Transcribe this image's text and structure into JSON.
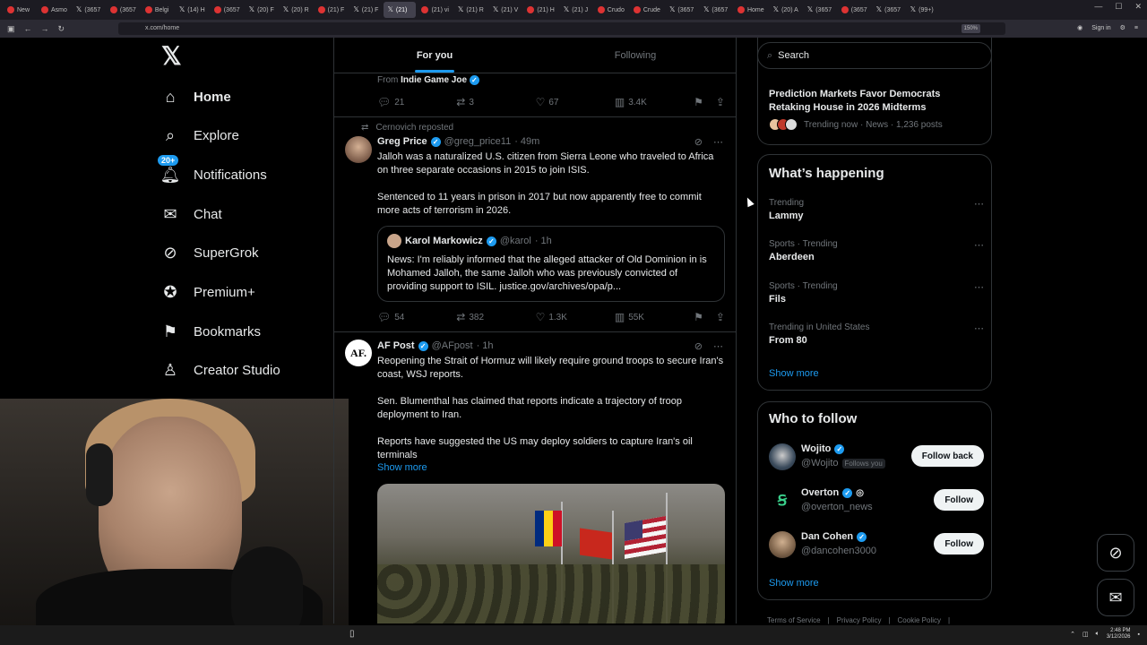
{
  "browser": {
    "tabs": [
      "New",
      "Asmo",
      "(3657",
      "(3657",
      "Belgi",
      "(14) H",
      "(3657",
      "(20) F",
      "(20) R",
      "(21) F",
      "(21) F",
      "(21)",
      "(21) vi",
      "(21) R",
      "(21) V",
      "(21) H",
      "(21) J",
      "Crudo",
      "Crude",
      "(3657",
      "(3657",
      "Home",
      "(20) A",
      "(3657",
      "(3657",
      "(3657",
      "(99+)"
    ],
    "active_tab_index": 11,
    "url": "x.com/home",
    "zoom": "150%",
    "signin": "Sign in"
  },
  "nav": {
    "home": "Home",
    "explore": "Explore",
    "notifications": "Notifications",
    "notifications_badge": "20+",
    "chat": "Chat",
    "supergrok": "SuperGrok",
    "premium": "Premium+",
    "bookmarks": "Bookmarks",
    "creator_studio": "Creator Studio"
  },
  "feed": {
    "tabs": [
      "For you",
      "Following"
    ],
    "prev": {
      "from_prefix": "From",
      "from_name": "Indie Game Joe",
      "replies": "21",
      "reposts": "3",
      "likes": "67",
      "views": "3.4K"
    },
    "tweet1": {
      "reposted_by": "Cernovich reposted",
      "name": "Greg Price",
      "handle": "@greg_price11",
      "time": "· 49m",
      "body": "Jalloh was a naturalized U.S. citizen from Sierra Leone who traveled to Africa on three separate occasions in 2015 to join ISIS.\n\nSentenced to 11 years in prison in 2017 but now apparently free to commit more acts of terrorism in 2026.",
      "quote_name": "Karol Markowicz",
      "quote_handle": "@karol",
      "quote_time": "· 1h",
      "quote_body": "News: I'm reliably informed that the alleged attacker of Old Dominion in is Mohamed Jalloh, the same Jalloh who was previously convicted of providing support to ISIL. justice.gov/archives/opa/p...",
      "replies": "54",
      "reposts": "382",
      "likes": "1.3K",
      "views": "55K"
    },
    "tweet2": {
      "avatar_text": "AF.",
      "name": "AF Post",
      "handle": "@AFpost",
      "time": "· 1h",
      "body": "Reopening the Strait of Hormuz will likely require ground troops to secure Iran's coast, WSJ reports.\n\nSen. Blumenthal has claimed that reports indicate a trajectory of troop deployment to Iran.\n\nReports have suggested the US may deploy soldiers to capture Iran's oil terminals",
      "show_more": "Show more"
    }
  },
  "sidebar": {
    "search_placeholder": "Search",
    "prediction": {
      "title": "Prediction Markets Favor Democrats Retaking House in 2026 Midterms",
      "meta": "Trending now · News · 1,236 posts"
    },
    "whats_happening": {
      "title": "What’s happening",
      "trends": [
        {
          "context": "Trending",
          "topic": "Lammy"
        },
        {
          "context": "Sports · Trending",
          "topic": "Aberdeen"
        },
        {
          "context": "Sports · Trending",
          "topic": "Fils"
        },
        {
          "context": "Trending in United States",
          "topic": "From 80"
        }
      ],
      "show_more": "Show more"
    },
    "who_to_follow": {
      "title": "Who to follow",
      "accounts": [
        {
          "name": "Wojito",
          "handle": "@Wojito",
          "follows_you": "Follows you",
          "button": "Follow back"
        },
        {
          "name": "Overton",
          "handle": "@overton_news",
          "button": "Follow"
        },
        {
          "name": "Dan Cohen",
          "handle": "@dancohen3000",
          "button": "Follow"
        }
      ],
      "show_more": "Show more"
    },
    "footer": [
      "Terms of Service",
      "|",
      "Privacy Policy",
      "|",
      "Cookie Policy",
      "|"
    ]
  },
  "taskbar": {
    "time": "2:48 PM",
    "date": "3/12/2026"
  },
  "colors": {
    "accent": "#1d9bf0",
    "background": "#000000",
    "border": "#2f3336",
    "muted_text": "#71767b"
  }
}
